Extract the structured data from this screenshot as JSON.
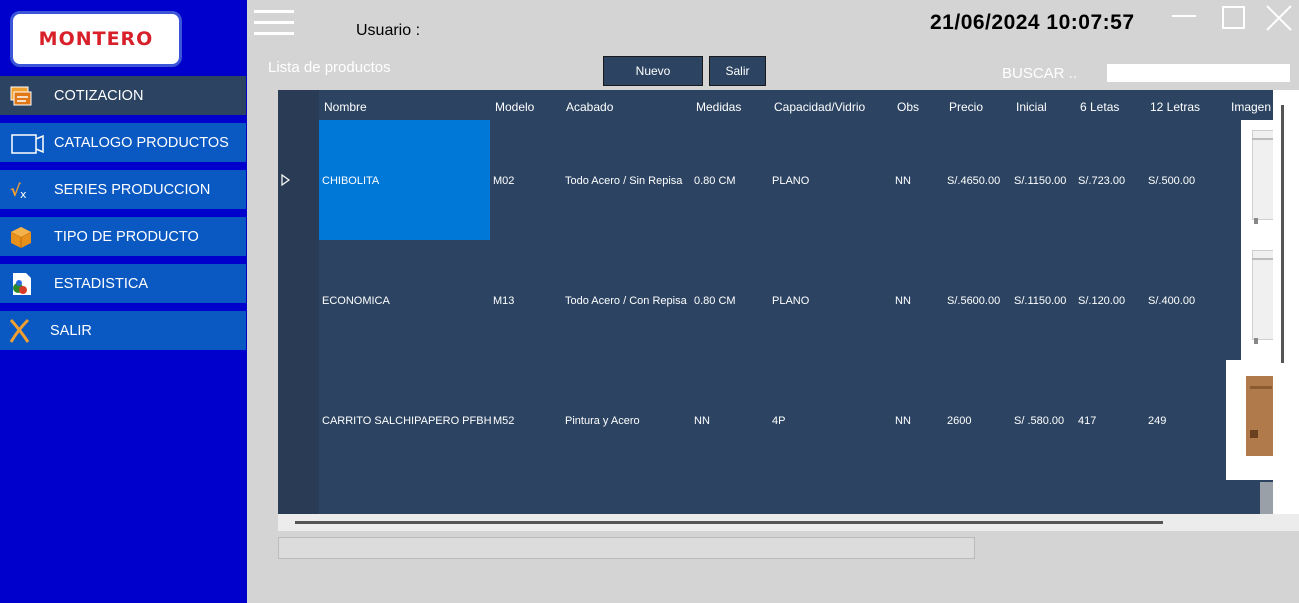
{
  "logo": {
    "text": "MONTERO"
  },
  "sidebar": {
    "items": [
      {
        "label": "COTIZACION",
        "icon": "quote-icon"
      },
      {
        "label": "CATALOGO PRODUCTOS",
        "icon": "catalog-icon"
      },
      {
        "label": "SERIES PRODUCCION",
        "icon": "series-icon"
      },
      {
        "label": "TIPO DE PRODUCTO",
        "icon": "box-icon"
      },
      {
        "label": "ESTADISTICA",
        "icon": "statistics-icon"
      },
      {
        "label": "SALIR",
        "icon": "exit-icon"
      }
    ]
  },
  "header": {
    "usuario_label": "Usuario :",
    "datetime": "21/06/2024 10:07:57"
  },
  "toolbar": {
    "title": "Lista de productos",
    "nuevo_label": "Nuevo",
    "salir_label": "Salir",
    "buscar_label": "BUSCAR ..",
    "search_value": ""
  },
  "table": {
    "columns": [
      "Nombre",
      "Modelo",
      "Acabado",
      "Medidas",
      "Capacidad/Vidrio",
      "Obs",
      "Precio",
      "Inicial",
      "6 Letas",
      "12 Letras",
      "Imagen"
    ],
    "rows": [
      [
        "CHIBOLITA",
        "M02",
        "Todo Acero / Sin Repisa",
        "0.80 CM",
        "PLANO",
        "NN",
        "S/.4650.00",
        "S/.1150.00",
        "S/.723.00",
        "S/.500.00"
      ],
      [
        "ECONOMICA",
        "M13",
        "Todo Acero / Con Repisa",
        "0.80 CM",
        "PLANO",
        "NN",
        "S/.5600.00",
        "S/.1150.00",
        "S/.120.00",
        "S/.400.00"
      ],
      [
        "CARRITO SALCHIPAPERO PFBH",
        "M52",
        "Pintura y Acero",
        "NN",
        "4P",
        "NN",
        "2600",
        "S/ .580.00",
        "417",
        "249"
      ]
    ]
  },
  "colors": {
    "sidebar_bg": "#0000cc",
    "nav_item_bg": "#0a58c2",
    "nav_active_bg": "#2c4462",
    "grid_bg": "#2c4462",
    "selection": "#0078d7",
    "logo_red": "#d8202a"
  }
}
